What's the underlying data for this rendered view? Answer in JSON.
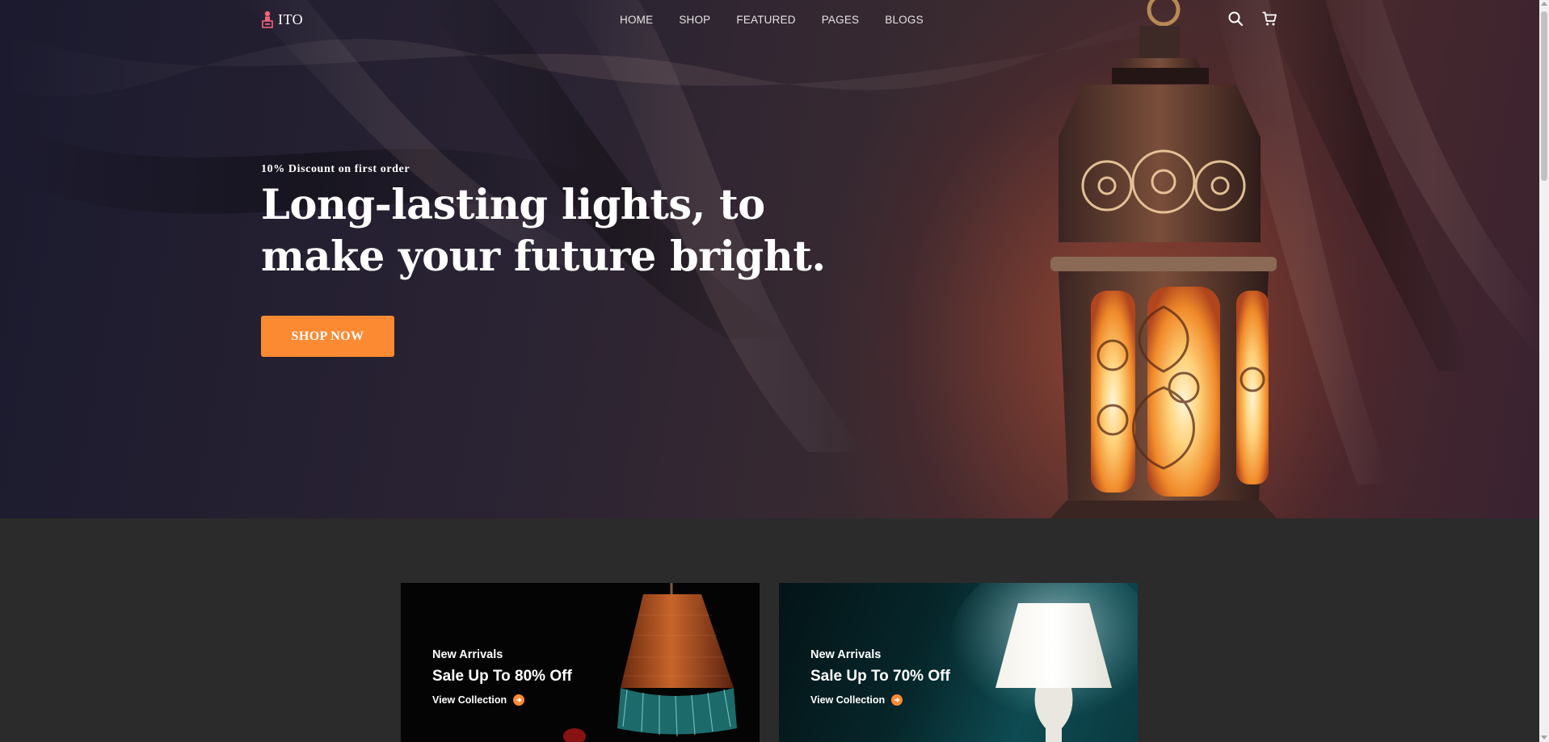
{
  "brand": {
    "name": "ITO",
    "accent": "#fb8a33"
  },
  "nav": {
    "items": [
      {
        "label": "HOME"
      },
      {
        "label": "SHOP"
      },
      {
        "label": "FEATURED"
      },
      {
        "label": "PAGES"
      },
      {
        "label": "BLOGS"
      }
    ],
    "icons": [
      "search-icon",
      "cart-icon"
    ]
  },
  "hero": {
    "eyebrow": "10% Discount on first order",
    "headline": "Long-lasting lights, to make your future bright.",
    "cta_label": "SHOP NOW"
  },
  "promos": [
    {
      "kicker": "New Arrivals",
      "title": "Sale Up To 80% Off",
      "link_label": "View Collection"
    },
    {
      "kicker": "New Arrivals",
      "title": "Sale Up To 70% Off",
      "link_label": "View Collection"
    }
  ]
}
